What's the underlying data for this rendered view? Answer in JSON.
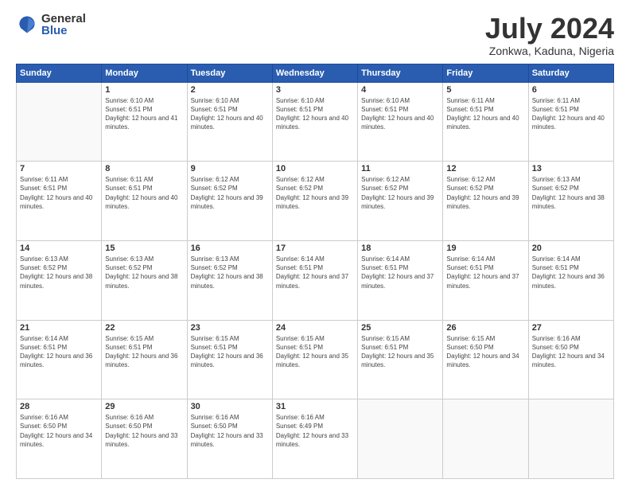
{
  "logo": {
    "general": "General",
    "blue": "Blue"
  },
  "header": {
    "month_year": "July 2024",
    "location": "Zonkwa, Kaduna, Nigeria"
  },
  "weekdays": [
    "Sunday",
    "Monday",
    "Tuesday",
    "Wednesday",
    "Thursday",
    "Friday",
    "Saturday"
  ],
  "weeks": [
    [
      {
        "day": "",
        "sunrise": "",
        "sunset": "",
        "daylight": ""
      },
      {
        "day": "1",
        "sunrise": "Sunrise: 6:10 AM",
        "sunset": "Sunset: 6:51 PM",
        "daylight": "Daylight: 12 hours and 41 minutes."
      },
      {
        "day": "2",
        "sunrise": "Sunrise: 6:10 AM",
        "sunset": "Sunset: 6:51 PM",
        "daylight": "Daylight: 12 hours and 40 minutes."
      },
      {
        "day": "3",
        "sunrise": "Sunrise: 6:10 AM",
        "sunset": "Sunset: 6:51 PM",
        "daylight": "Daylight: 12 hours and 40 minutes."
      },
      {
        "day": "4",
        "sunrise": "Sunrise: 6:10 AM",
        "sunset": "Sunset: 6:51 PM",
        "daylight": "Daylight: 12 hours and 40 minutes."
      },
      {
        "day": "5",
        "sunrise": "Sunrise: 6:11 AM",
        "sunset": "Sunset: 6:51 PM",
        "daylight": "Daylight: 12 hours and 40 minutes."
      },
      {
        "day": "6",
        "sunrise": "Sunrise: 6:11 AM",
        "sunset": "Sunset: 6:51 PM",
        "daylight": "Daylight: 12 hours and 40 minutes."
      }
    ],
    [
      {
        "day": "7",
        "sunrise": "Sunrise: 6:11 AM",
        "sunset": "Sunset: 6:51 PM",
        "daylight": "Daylight: 12 hours and 40 minutes."
      },
      {
        "day": "8",
        "sunrise": "Sunrise: 6:11 AM",
        "sunset": "Sunset: 6:51 PM",
        "daylight": "Daylight: 12 hours and 40 minutes."
      },
      {
        "day": "9",
        "sunrise": "Sunrise: 6:12 AM",
        "sunset": "Sunset: 6:52 PM",
        "daylight": "Daylight: 12 hours and 39 minutes."
      },
      {
        "day": "10",
        "sunrise": "Sunrise: 6:12 AM",
        "sunset": "Sunset: 6:52 PM",
        "daylight": "Daylight: 12 hours and 39 minutes."
      },
      {
        "day": "11",
        "sunrise": "Sunrise: 6:12 AM",
        "sunset": "Sunset: 6:52 PM",
        "daylight": "Daylight: 12 hours and 39 minutes."
      },
      {
        "day": "12",
        "sunrise": "Sunrise: 6:12 AM",
        "sunset": "Sunset: 6:52 PM",
        "daylight": "Daylight: 12 hours and 39 minutes."
      },
      {
        "day": "13",
        "sunrise": "Sunrise: 6:13 AM",
        "sunset": "Sunset: 6:52 PM",
        "daylight": "Daylight: 12 hours and 38 minutes."
      }
    ],
    [
      {
        "day": "14",
        "sunrise": "Sunrise: 6:13 AM",
        "sunset": "Sunset: 6:52 PM",
        "daylight": "Daylight: 12 hours and 38 minutes."
      },
      {
        "day": "15",
        "sunrise": "Sunrise: 6:13 AM",
        "sunset": "Sunset: 6:52 PM",
        "daylight": "Daylight: 12 hours and 38 minutes."
      },
      {
        "day": "16",
        "sunrise": "Sunrise: 6:13 AM",
        "sunset": "Sunset: 6:52 PM",
        "daylight": "Daylight: 12 hours and 38 minutes."
      },
      {
        "day": "17",
        "sunrise": "Sunrise: 6:14 AM",
        "sunset": "Sunset: 6:51 PM",
        "daylight": "Daylight: 12 hours and 37 minutes."
      },
      {
        "day": "18",
        "sunrise": "Sunrise: 6:14 AM",
        "sunset": "Sunset: 6:51 PM",
        "daylight": "Daylight: 12 hours and 37 minutes."
      },
      {
        "day": "19",
        "sunrise": "Sunrise: 6:14 AM",
        "sunset": "Sunset: 6:51 PM",
        "daylight": "Daylight: 12 hours and 37 minutes."
      },
      {
        "day": "20",
        "sunrise": "Sunrise: 6:14 AM",
        "sunset": "Sunset: 6:51 PM",
        "daylight": "Daylight: 12 hours and 36 minutes."
      }
    ],
    [
      {
        "day": "21",
        "sunrise": "Sunrise: 6:14 AM",
        "sunset": "Sunset: 6:51 PM",
        "daylight": "Daylight: 12 hours and 36 minutes."
      },
      {
        "day": "22",
        "sunrise": "Sunrise: 6:15 AM",
        "sunset": "Sunset: 6:51 PM",
        "daylight": "Daylight: 12 hours and 36 minutes."
      },
      {
        "day": "23",
        "sunrise": "Sunrise: 6:15 AM",
        "sunset": "Sunset: 6:51 PM",
        "daylight": "Daylight: 12 hours and 36 minutes."
      },
      {
        "day": "24",
        "sunrise": "Sunrise: 6:15 AM",
        "sunset": "Sunset: 6:51 PM",
        "daylight": "Daylight: 12 hours and 35 minutes."
      },
      {
        "day": "25",
        "sunrise": "Sunrise: 6:15 AM",
        "sunset": "Sunset: 6:51 PM",
        "daylight": "Daylight: 12 hours and 35 minutes."
      },
      {
        "day": "26",
        "sunrise": "Sunrise: 6:15 AM",
        "sunset": "Sunset: 6:50 PM",
        "daylight": "Daylight: 12 hours and 34 minutes."
      },
      {
        "day": "27",
        "sunrise": "Sunrise: 6:16 AM",
        "sunset": "Sunset: 6:50 PM",
        "daylight": "Daylight: 12 hours and 34 minutes."
      }
    ],
    [
      {
        "day": "28",
        "sunrise": "Sunrise: 6:16 AM",
        "sunset": "Sunset: 6:50 PM",
        "daylight": "Daylight: 12 hours and 34 minutes."
      },
      {
        "day": "29",
        "sunrise": "Sunrise: 6:16 AM",
        "sunset": "Sunset: 6:50 PM",
        "daylight": "Daylight: 12 hours and 33 minutes."
      },
      {
        "day": "30",
        "sunrise": "Sunrise: 6:16 AM",
        "sunset": "Sunset: 6:50 PM",
        "daylight": "Daylight: 12 hours and 33 minutes."
      },
      {
        "day": "31",
        "sunrise": "Sunrise: 6:16 AM",
        "sunset": "Sunset: 6:49 PM",
        "daylight": "Daylight: 12 hours and 33 minutes."
      },
      {
        "day": "",
        "sunrise": "",
        "sunset": "",
        "daylight": ""
      },
      {
        "day": "",
        "sunrise": "",
        "sunset": "",
        "daylight": ""
      },
      {
        "day": "",
        "sunrise": "",
        "sunset": "",
        "daylight": ""
      }
    ]
  ]
}
